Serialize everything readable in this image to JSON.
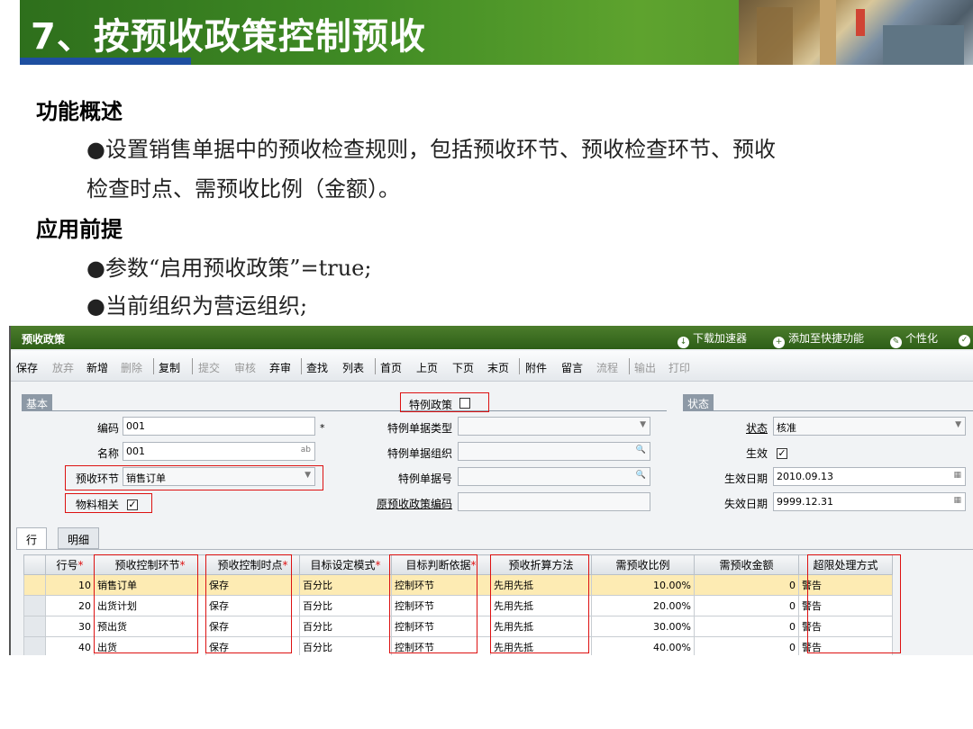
{
  "slide": {
    "title": "7、按预收政策控制预收",
    "sections": [
      {
        "heading": "功能概述",
        "bullets": [
          "●设置销售单据中的预收检查规则，包括预收环节、预收检查环节、预收",
          "检查时点、需预收比例（金额）。"
        ]
      },
      {
        "heading": "应用前提",
        "bullets": [
          "●参数“启用预收政策”=true;",
          "●当前组织为营运组织;"
        ]
      }
    ]
  },
  "app": {
    "title": "预收政策",
    "top_links": [
      {
        "icon": "download-icon",
        "label": "下载加速器"
      },
      {
        "icon": "add-shortcut-icon",
        "label": "添加至快捷功能"
      },
      {
        "icon": "personalize-icon",
        "label": "个性化"
      }
    ],
    "toolbar": [
      "保存",
      "放弃",
      "新增",
      "删除",
      "复制",
      "提交",
      "审核",
      "弃审",
      "查找",
      "列表",
      "首页",
      "上页",
      "下页",
      "末页",
      "附件",
      "留言",
      "流程",
      "输出",
      "打印"
    ],
    "form": {
      "basic_section": "基本",
      "status_section": "状态",
      "code_label": "编码",
      "code_value": "001",
      "name_label": "名称",
      "name_value": "001",
      "name_suffix": "ab",
      "stage_label": "预收环节",
      "stage_value": "销售订单",
      "material_label": "物料相关",
      "special_policy_label": "特例政策",
      "special_type_label": "特例单据类型",
      "special_org_label": "特例单据组织",
      "special_no_label": "特例单据号",
      "orig_code_label": "原预收政策编码",
      "state_label": "状态",
      "state_value": "核准",
      "effective_label": "生效",
      "eff_date_label": "生效日期",
      "eff_date_value": "2010.09.13",
      "exp_date_label": "失效日期",
      "exp_date_value": "9999.12.31",
      "required_mark": "*",
      "check_mark": "✓"
    },
    "tabs": [
      "行",
      "明细"
    ],
    "grid": {
      "columns": [
        "行号",
        "预收控制环节",
        "预收控制时点",
        "目标设定模式",
        "目标判断依据",
        "预收折算方法",
        "需预收比例",
        "需预收金额",
        "超限处理方式"
      ],
      "required_cols": [
        0,
        1,
        2,
        3,
        4
      ],
      "rows": [
        [
          "10",
          "销售订单",
          "保存",
          "百分比",
          "控制环节",
          "先用先抵",
          "10.00%",
          "0",
          "警告"
        ],
        [
          "20",
          "出货计划",
          "保存",
          "百分比",
          "控制环节",
          "先用先抵",
          "20.00%",
          "0",
          "警告"
        ],
        [
          "30",
          "预出货",
          "保存",
          "百分比",
          "控制环节",
          "先用先抵",
          "30.00%",
          "0",
          "警告"
        ],
        [
          "40",
          "出货",
          "保存",
          "百分比",
          "控制环节",
          "先用先抵",
          "40.00%",
          "0",
          "警告"
        ]
      ]
    }
  }
}
